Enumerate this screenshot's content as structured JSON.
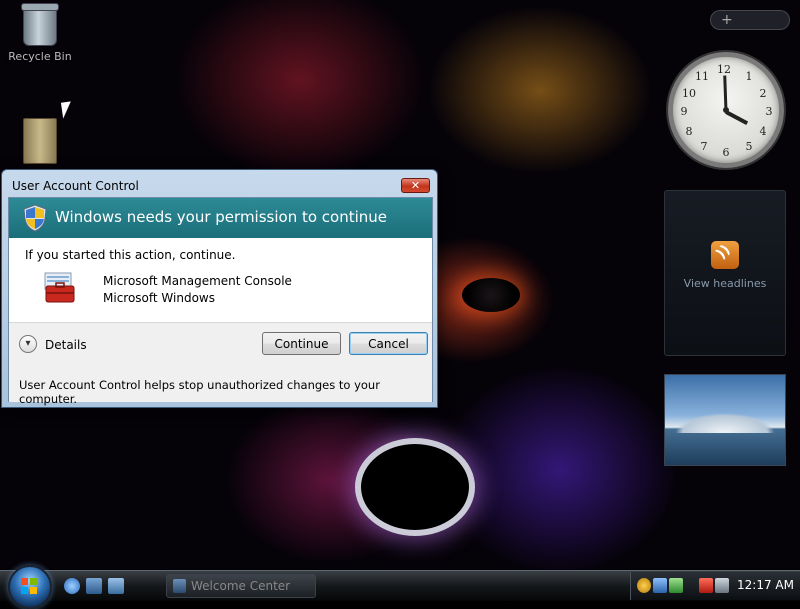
{
  "desktop": {
    "icons": [
      {
        "label": "Recycle Bin"
      },
      {
        "label": ""
      }
    ]
  },
  "sidebar": {
    "toggle_label": "+",
    "feed_label": "View headlines",
    "clock_numbers": [
      "12",
      "1",
      "2",
      "3",
      "4",
      "5",
      "6",
      "7",
      "8",
      "9",
      "10",
      "11"
    ]
  },
  "uac": {
    "window_title": "User Account Control",
    "close_label": "✕",
    "banner_title": "Windows needs your permission to continue",
    "message": "If you started this action, continue.",
    "program_name": "Microsoft Management Console",
    "publisher": "Microsoft Windows",
    "details_label": "Details",
    "continue_label": "Continue",
    "cancel_label": "Cancel",
    "footer_text": "User Account Control helps stop unauthorized changes to your computer."
  },
  "taskbar": {
    "active_task": "Welcome Center",
    "time": "12:17 AM"
  },
  "colors": {
    "banner": "#1b6e7a",
    "close_button": "#c0341c",
    "taskbar": "#15181b"
  },
  "icons": [
    "recycle-bin-icon",
    "folder-icon",
    "shield-icon",
    "toolbox-icon",
    "rss-icon",
    "start-orb-icon"
  ]
}
